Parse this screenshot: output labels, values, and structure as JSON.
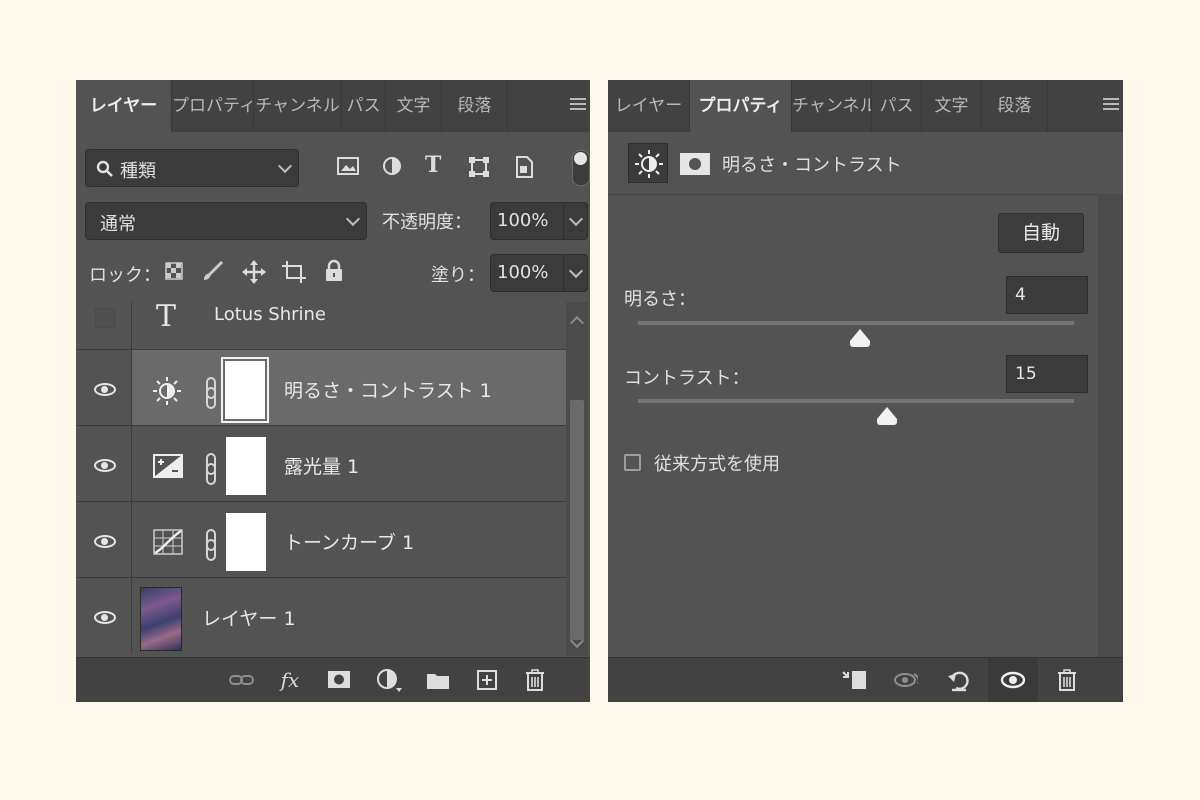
{
  "layers_panel": {
    "tabs": [
      "レイヤー",
      "プロパティ",
      "チャンネル",
      "パス",
      "文字",
      "段落"
    ],
    "active_tab": "レイヤー",
    "filter": {
      "label": "種類"
    },
    "blend_mode": "通常",
    "opacity": {
      "label": "不透明度：",
      "value": "100%"
    },
    "lock": {
      "label": "ロック："
    },
    "fill": {
      "label": "塗り：",
      "value": "100%"
    },
    "layers": [
      {
        "name": "Lotus Shrine",
        "type": "text",
        "visible": false,
        "selected": false
      },
      {
        "name": "明るさ・コントラスト 1",
        "type": "brightness-contrast",
        "visible": true,
        "selected": true
      },
      {
        "name": "露光量 1",
        "type": "exposure",
        "visible": true,
        "selected": false
      },
      {
        "name": "トーンカーブ 1",
        "type": "curves",
        "visible": true,
        "selected": false
      },
      {
        "name": "レイヤー 1",
        "type": "pixel",
        "visible": true,
        "selected": false
      }
    ]
  },
  "properties_panel": {
    "tabs": [
      "レイヤー",
      "プロパティ",
      "チャンネル",
      "パス",
      "文字",
      "段落"
    ],
    "active_tab": "プロパティ",
    "header_title": "明るさ・コントラスト",
    "auto_button": "自動",
    "brightness": {
      "label": "明るさ：",
      "value": "4",
      "level": 0.51
    },
    "contrast": {
      "label": "コントラスト：",
      "value": "15",
      "level": 0.57
    },
    "legacy_checkbox": {
      "label": "従来方式を使用",
      "checked": false
    }
  },
  "colors": {
    "page_background": "#fdf8ea",
    "panel_background": "#535353",
    "tab_bar": "#424242",
    "selected_row": "#6a6a6a"
  }
}
